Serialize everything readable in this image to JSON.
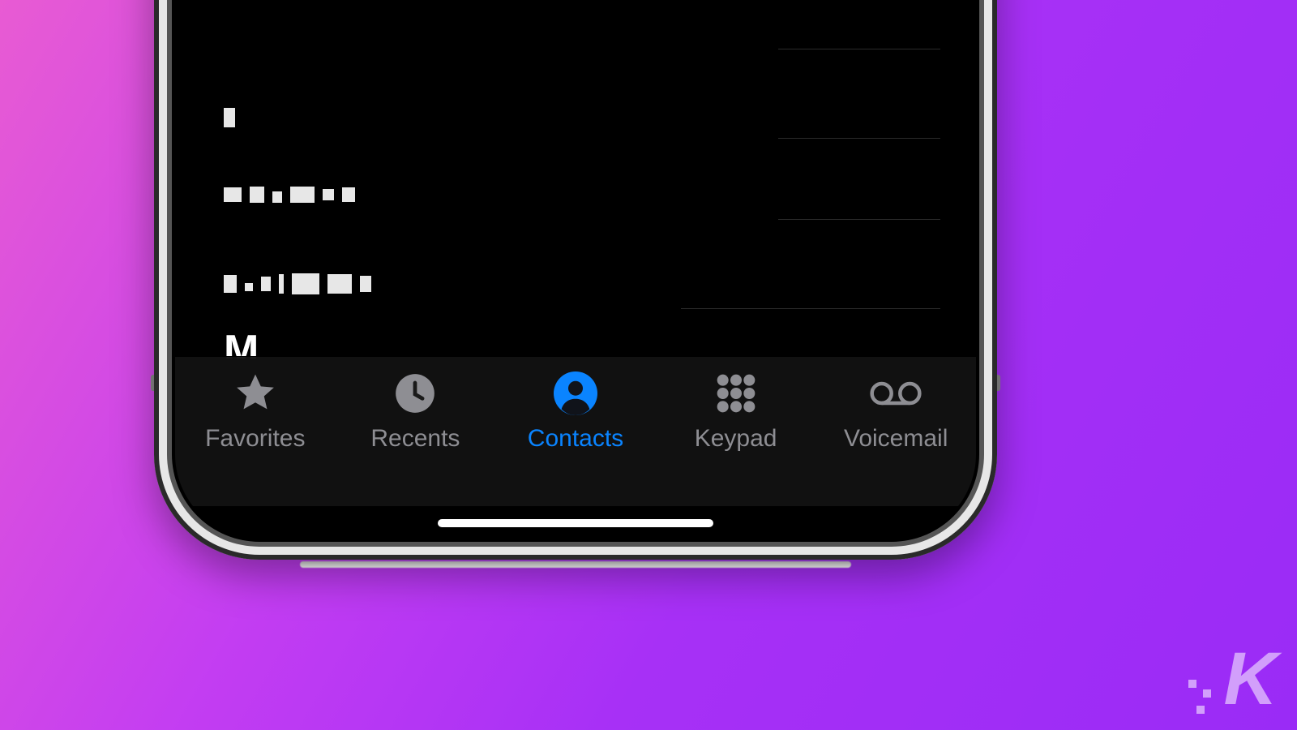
{
  "index": {
    "hash": "#"
  },
  "contacts": {
    "rows": [
      {
        "redacted": true
      },
      {
        "redacted": true
      },
      {
        "redacted": true
      },
      {
        "partial_text": "M"
      }
    ]
  },
  "tabs": {
    "favorites": {
      "label": "Favorites"
    },
    "recents": {
      "label": "Recents"
    },
    "contacts": {
      "label": "Contacts",
      "active": true
    },
    "keypad": {
      "label": "Keypad"
    },
    "voicemail": {
      "label": "Voicemail"
    }
  },
  "watermark": {
    "letter": "K"
  },
  "colors": {
    "accent": "#0a84ff",
    "inactive": "#8e8e93"
  }
}
